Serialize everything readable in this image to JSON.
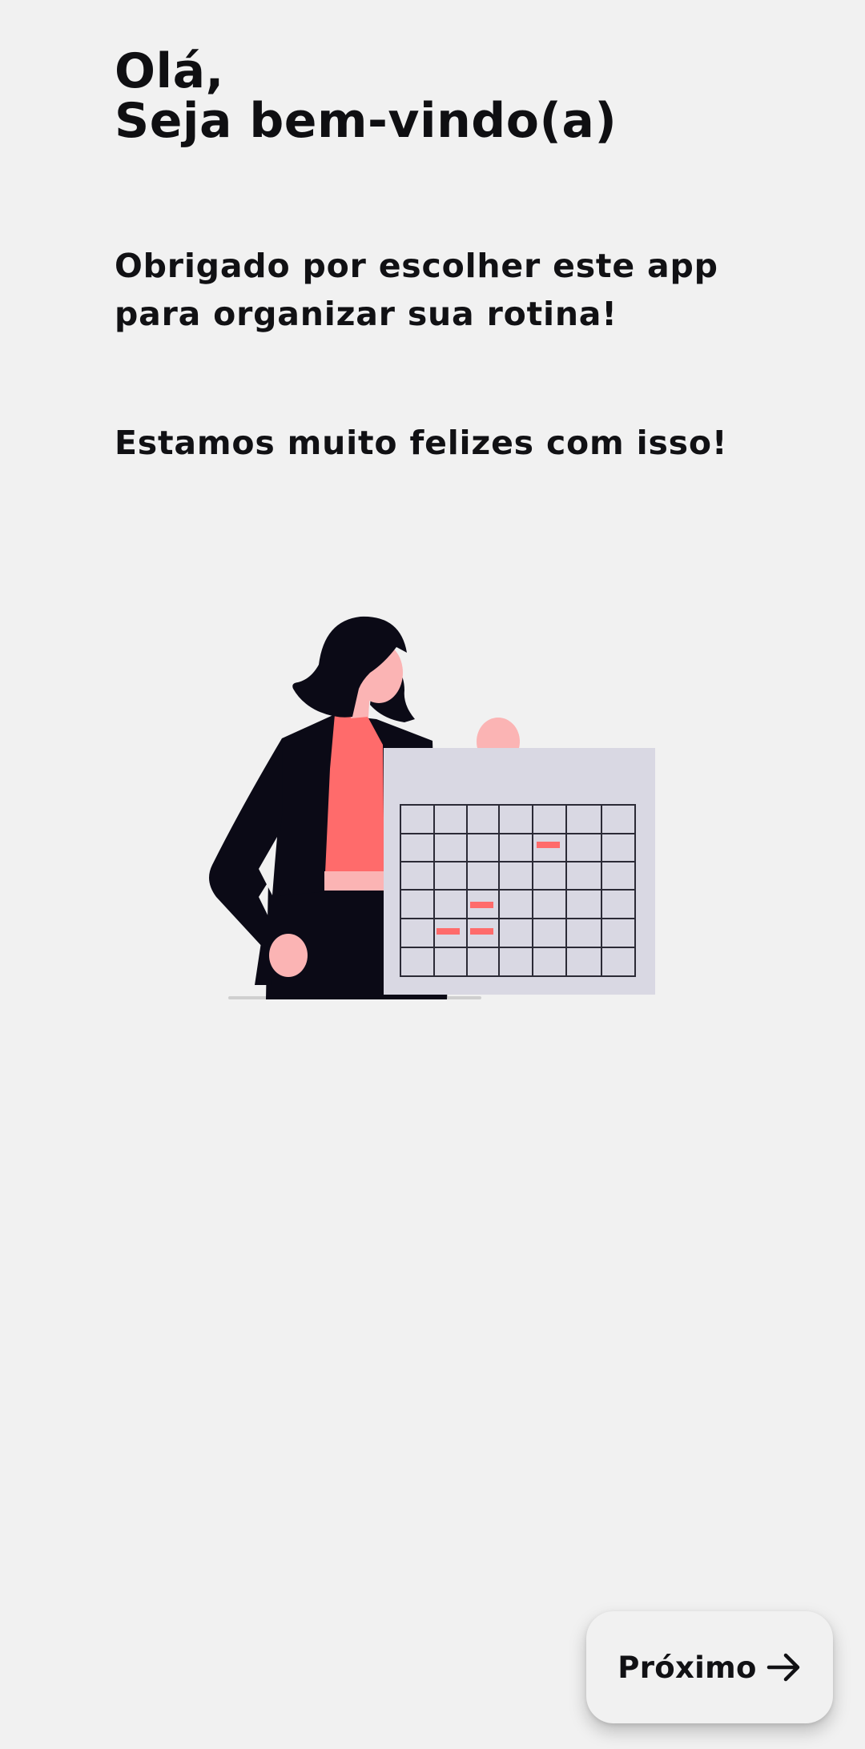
{
  "header": {
    "greeting_line1": "Olá,",
    "greeting_line2": "Seja bem-vindo(a)"
  },
  "body": {
    "thanks_line1": "Obrigado por escolher este app",
    "thanks_line2": "para organizar sua rotina!",
    "happy_text": "Estamos muito felizes com isso!"
  },
  "illustration": {
    "name": "woman-holding-calendar-illustration",
    "colors": {
      "dark": "#0b0a16",
      "skin": "#fbb4b4",
      "accent": "#ff6b6b",
      "calendar_bg": "#d9d8e3",
      "ground": "#cfcfcf"
    }
  },
  "footer": {
    "next_label": "Próximo",
    "next_icon": "arrow-right-icon"
  }
}
